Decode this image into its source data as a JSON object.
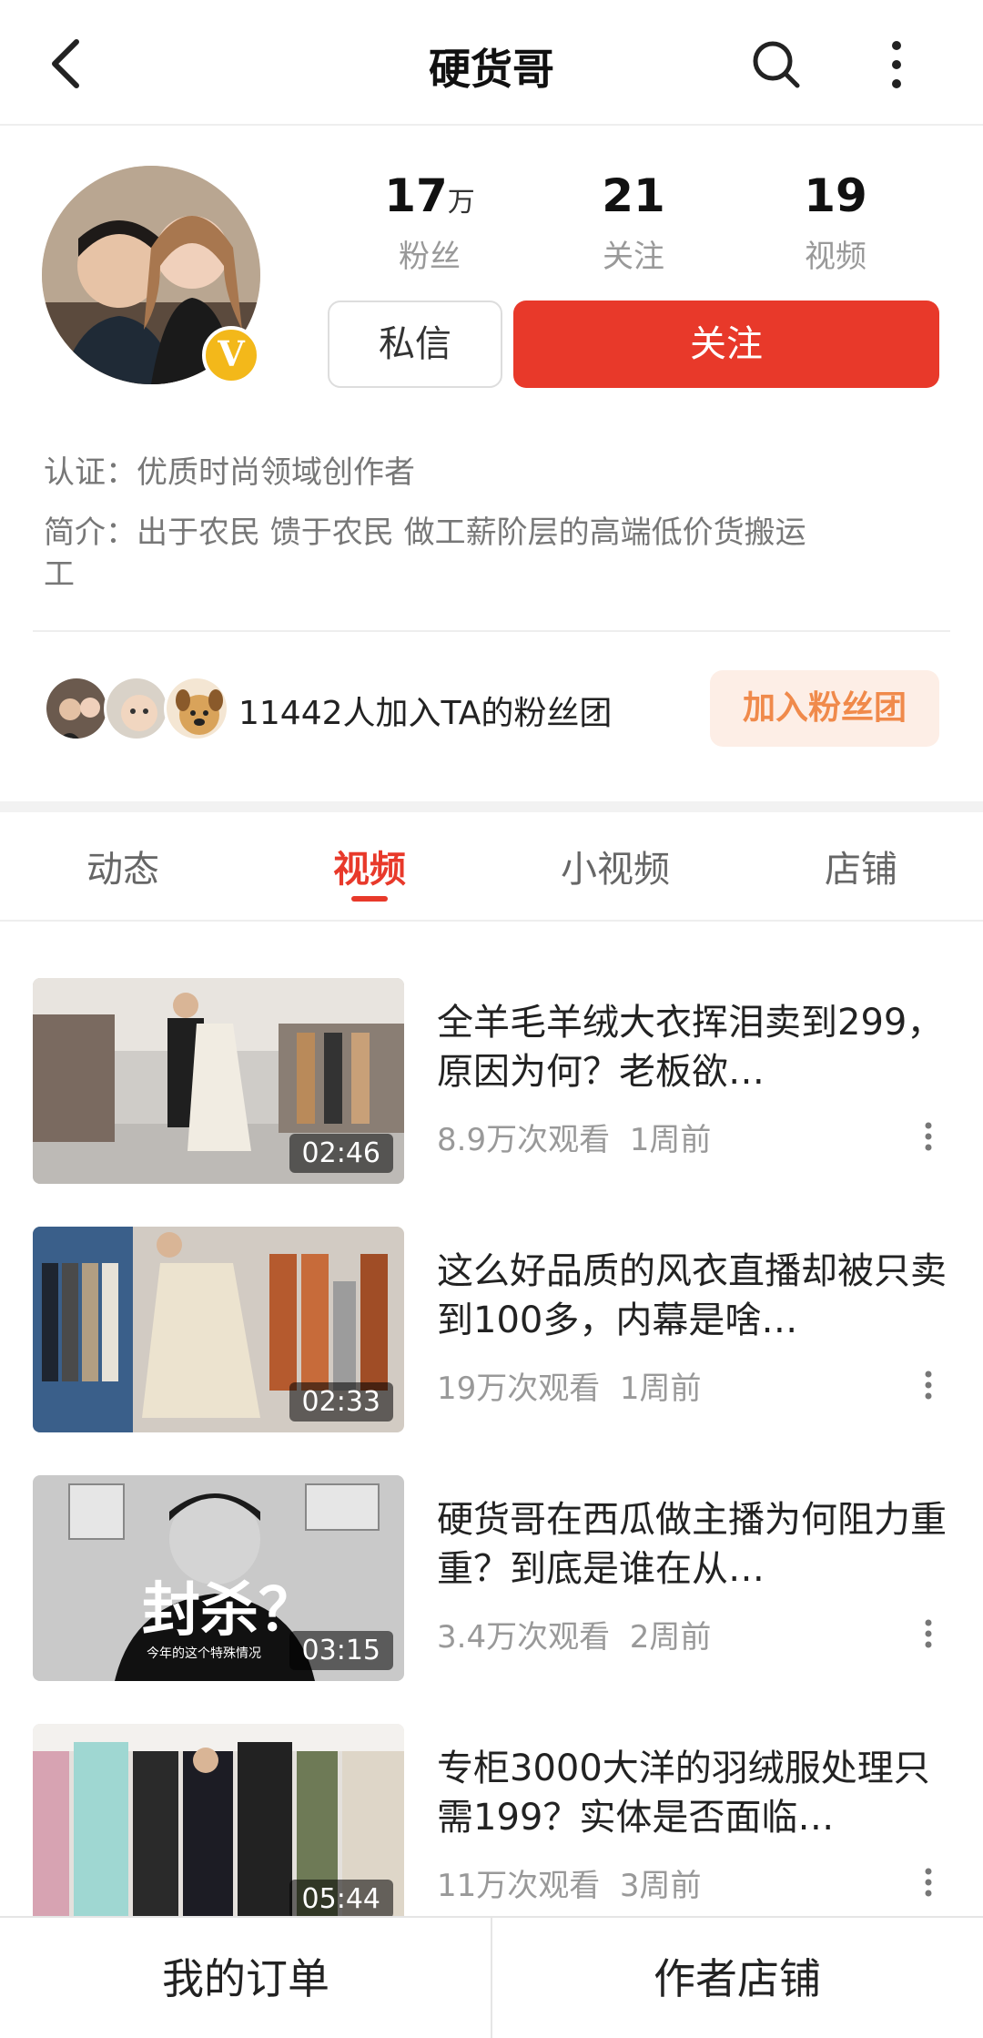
{
  "header": {
    "title": "硬货哥",
    "back_icon": "back-arrow-icon",
    "search_icon": "search-icon",
    "more_icon": "more-vertical-icon"
  },
  "profile": {
    "verified_badge": "V",
    "stats": [
      {
        "value": "17",
        "unit": "万",
        "label": "粉丝"
      },
      {
        "value": "21",
        "unit": "",
        "label": "关注"
      },
      {
        "value": "19",
        "unit": "",
        "label": "视频"
      }
    ],
    "message_label": "私信",
    "follow_label": "关注",
    "certification": "认证：优质时尚领域创作者",
    "intro_line1": "简介：出于农民 馈于农民 做工薪阶层的高端低价货搬运",
    "intro_line2": "工",
    "fan_group_text": "11442人加入TA的粉丝团",
    "join_fan_group_label": "加入粉丝团"
  },
  "tabs": [
    {
      "label": "动态",
      "active": false
    },
    {
      "label": "视频",
      "active": true
    },
    {
      "label": "小视频",
      "active": false
    },
    {
      "label": "店铺",
      "active": false
    }
  ],
  "videos": [
    {
      "title": "全羊毛羊绒大衣挥泪卖到299，原因为何？老板欲…",
      "views": "8.9万次观看",
      "time": "1周前",
      "duration": "02:46"
    },
    {
      "title": "这么好品质的风衣直播却被只卖到100多，内幕是啥…",
      "views": "19万次观看",
      "time": "1周前",
      "duration": "02:33"
    },
    {
      "title": "硬货哥在西瓜做主播为何阻力重重？到底是谁在从…",
      "views": "3.4万次观看",
      "time": "2周前",
      "duration": "03:15",
      "overlay_text": "封杀？",
      "overlay_sub": "今年的这个特殊情况"
    },
    {
      "title": "专柜3000大洋的羽绒服处理只需199？实体是否面临…",
      "views": "11万次观看",
      "time": "3周前",
      "duration": "05:44"
    }
  ],
  "bottom_bar": {
    "orders_label": "我的订单",
    "shop_label": "作者店铺"
  },
  "colors": {
    "accent": "#e8392a",
    "badge": "#f3b81a",
    "join_bg": "#fdeee6",
    "join_text": "#f08a4b"
  }
}
